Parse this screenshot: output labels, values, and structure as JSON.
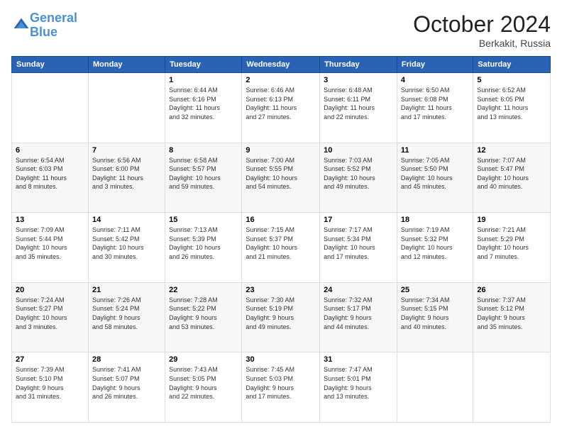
{
  "header": {
    "logo_line1": "General",
    "logo_line2": "Blue",
    "month": "October 2024",
    "location": "Berkakit, Russia"
  },
  "days_of_week": [
    "Sunday",
    "Monday",
    "Tuesday",
    "Wednesday",
    "Thursday",
    "Friday",
    "Saturday"
  ],
  "weeks": [
    [
      {
        "day": "",
        "info": ""
      },
      {
        "day": "",
        "info": ""
      },
      {
        "day": "1",
        "info": "Sunrise: 6:44 AM\nSunset: 6:16 PM\nDaylight: 11 hours\nand 32 minutes."
      },
      {
        "day": "2",
        "info": "Sunrise: 6:46 AM\nSunset: 6:13 PM\nDaylight: 11 hours\nand 27 minutes."
      },
      {
        "day": "3",
        "info": "Sunrise: 6:48 AM\nSunset: 6:11 PM\nDaylight: 11 hours\nand 22 minutes."
      },
      {
        "day": "4",
        "info": "Sunrise: 6:50 AM\nSunset: 6:08 PM\nDaylight: 11 hours\nand 17 minutes."
      },
      {
        "day": "5",
        "info": "Sunrise: 6:52 AM\nSunset: 6:05 PM\nDaylight: 11 hours\nand 13 minutes."
      }
    ],
    [
      {
        "day": "6",
        "info": "Sunrise: 6:54 AM\nSunset: 6:03 PM\nDaylight: 11 hours\nand 8 minutes."
      },
      {
        "day": "7",
        "info": "Sunrise: 6:56 AM\nSunset: 6:00 PM\nDaylight: 11 hours\nand 3 minutes."
      },
      {
        "day": "8",
        "info": "Sunrise: 6:58 AM\nSunset: 5:57 PM\nDaylight: 10 hours\nand 59 minutes."
      },
      {
        "day": "9",
        "info": "Sunrise: 7:00 AM\nSunset: 5:55 PM\nDaylight: 10 hours\nand 54 minutes."
      },
      {
        "day": "10",
        "info": "Sunrise: 7:03 AM\nSunset: 5:52 PM\nDaylight: 10 hours\nand 49 minutes."
      },
      {
        "day": "11",
        "info": "Sunrise: 7:05 AM\nSunset: 5:50 PM\nDaylight: 10 hours\nand 45 minutes."
      },
      {
        "day": "12",
        "info": "Sunrise: 7:07 AM\nSunset: 5:47 PM\nDaylight: 10 hours\nand 40 minutes."
      }
    ],
    [
      {
        "day": "13",
        "info": "Sunrise: 7:09 AM\nSunset: 5:44 PM\nDaylight: 10 hours\nand 35 minutes."
      },
      {
        "day": "14",
        "info": "Sunrise: 7:11 AM\nSunset: 5:42 PM\nDaylight: 10 hours\nand 30 minutes."
      },
      {
        "day": "15",
        "info": "Sunrise: 7:13 AM\nSunset: 5:39 PM\nDaylight: 10 hours\nand 26 minutes."
      },
      {
        "day": "16",
        "info": "Sunrise: 7:15 AM\nSunset: 5:37 PM\nDaylight: 10 hours\nand 21 minutes."
      },
      {
        "day": "17",
        "info": "Sunrise: 7:17 AM\nSunset: 5:34 PM\nDaylight: 10 hours\nand 17 minutes."
      },
      {
        "day": "18",
        "info": "Sunrise: 7:19 AM\nSunset: 5:32 PM\nDaylight: 10 hours\nand 12 minutes."
      },
      {
        "day": "19",
        "info": "Sunrise: 7:21 AM\nSunset: 5:29 PM\nDaylight: 10 hours\nand 7 minutes."
      }
    ],
    [
      {
        "day": "20",
        "info": "Sunrise: 7:24 AM\nSunset: 5:27 PM\nDaylight: 10 hours\nand 3 minutes."
      },
      {
        "day": "21",
        "info": "Sunrise: 7:26 AM\nSunset: 5:24 PM\nDaylight: 9 hours\nand 58 minutes."
      },
      {
        "day": "22",
        "info": "Sunrise: 7:28 AM\nSunset: 5:22 PM\nDaylight: 9 hours\nand 53 minutes."
      },
      {
        "day": "23",
        "info": "Sunrise: 7:30 AM\nSunset: 5:19 PM\nDaylight: 9 hours\nand 49 minutes."
      },
      {
        "day": "24",
        "info": "Sunrise: 7:32 AM\nSunset: 5:17 PM\nDaylight: 9 hours\nand 44 minutes."
      },
      {
        "day": "25",
        "info": "Sunrise: 7:34 AM\nSunset: 5:15 PM\nDaylight: 9 hours\nand 40 minutes."
      },
      {
        "day": "26",
        "info": "Sunrise: 7:37 AM\nSunset: 5:12 PM\nDaylight: 9 hours\nand 35 minutes."
      }
    ],
    [
      {
        "day": "27",
        "info": "Sunrise: 7:39 AM\nSunset: 5:10 PM\nDaylight: 9 hours\nand 31 minutes."
      },
      {
        "day": "28",
        "info": "Sunrise: 7:41 AM\nSunset: 5:07 PM\nDaylight: 9 hours\nand 26 minutes."
      },
      {
        "day": "29",
        "info": "Sunrise: 7:43 AM\nSunset: 5:05 PM\nDaylight: 9 hours\nand 22 minutes."
      },
      {
        "day": "30",
        "info": "Sunrise: 7:45 AM\nSunset: 5:03 PM\nDaylight: 9 hours\nand 17 minutes."
      },
      {
        "day": "31",
        "info": "Sunrise: 7:47 AM\nSunset: 5:01 PM\nDaylight: 9 hours\nand 13 minutes."
      },
      {
        "day": "",
        "info": ""
      },
      {
        "day": "",
        "info": ""
      }
    ]
  ]
}
